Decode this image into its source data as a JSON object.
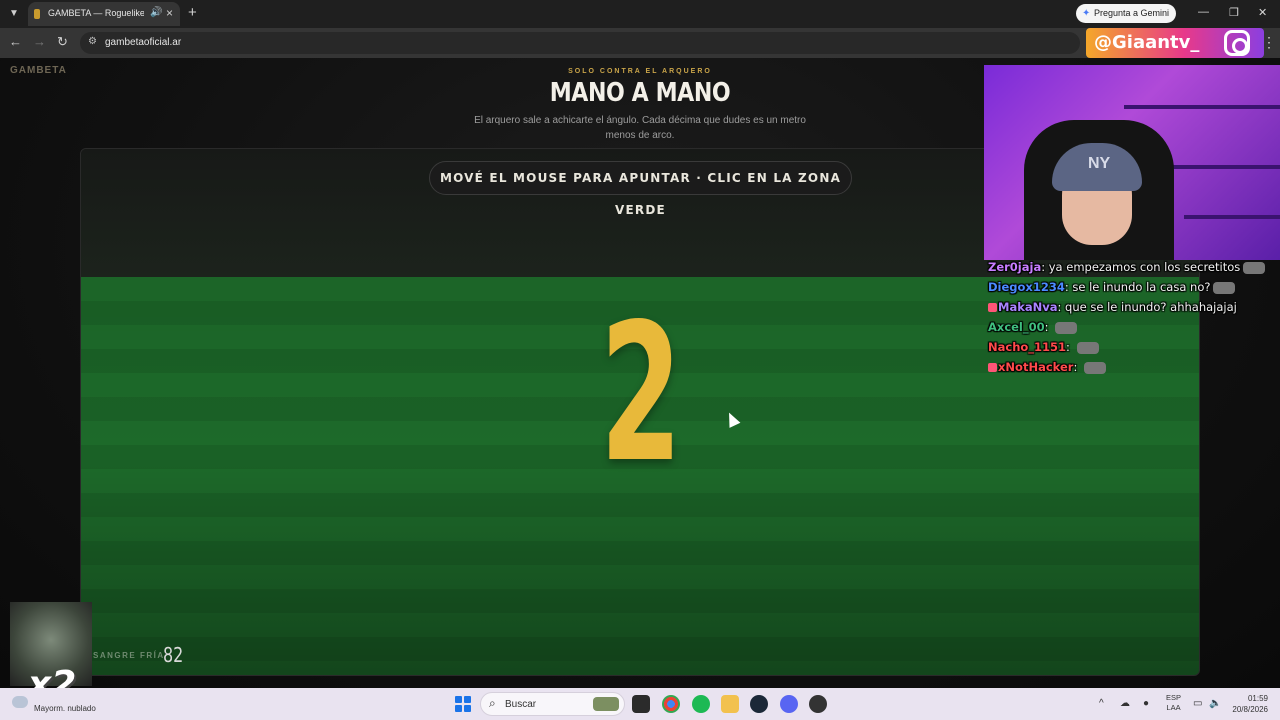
{
  "browser": {
    "tab_title": "GAMBETA — Roguelike de",
    "new_tab_label": "+",
    "gemini_label": "Pregunta a Gemini",
    "url": "gambetaoficial.ar"
  },
  "overlay": {
    "instagram_handle": "@Giaantv_",
    "multiplier": "x2"
  },
  "page": {
    "logo": "GAMBETA",
    "kicker": "SOLO CONTRA EL ARQUERO",
    "title": "MANO A MANO",
    "description": "El arquero sale a achicarte el ángulo. Cada décima que dudes es un metro menos de arco.",
    "instruction": "MOVÉ EL MOUSE PARA APUNTAR · CLIC EN LA ZONA VERDE",
    "countdown": "2",
    "stat_label": "SANGRE FRÍA",
    "stat_value": "82"
  },
  "chat": [
    {
      "user": "Zer0jaja",
      "color": "#c77dff",
      "message": "ya empezamos con los secretitos",
      "emote": true
    },
    {
      "user": "Diegox1234",
      "color": "#4b8bff",
      "message": "se le inundo la casa no?",
      "emote": true
    },
    {
      "user": "MakaNva",
      "color": "#a884ff",
      "message": "que se le inundo? ahhahajajaj",
      "emote": false,
      "badges": true
    },
    {
      "user": "Axcel_00",
      "color": "#3fbf7f",
      "message": "",
      "emote": true
    },
    {
      "user": "Nacho_1151",
      "color": "#ff4b4b",
      "message": "",
      "emote": true
    },
    {
      "user": "xNotHacker",
      "color": "#ff4b4b",
      "message": "",
      "emote": true,
      "badges": true
    }
  ],
  "taskbar": {
    "weather": "Mayorm. nublado",
    "search_placeholder": "Buscar",
    "lang_line1": "ESP",
    "lang_line2": "LAA",
    "time": "01:59",
    "date": "20/8/2026"
  }
}
